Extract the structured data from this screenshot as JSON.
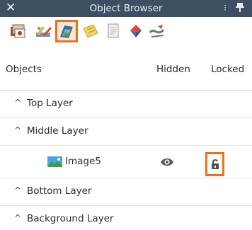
{
  "window": {
    "title": "Object Browser",
    "close_glyph": "✕",
    "menu_glyph": "⁝"
  },
  "toolbar": {
    "tools": [
      {
        "name": "objects-tool-icon"
      },
      {
        "name": "paths-tool-icon"
      },
      {
        "name": "images-tool-icon",
        "active": true
      },
      {
        "name": "notes-tool-icon"
      },
      {
        "name": "pages-tool-icon"
      },
      {
        "name": "shapes-tool-icon"
      },
      {
        "name": "strokes-tool-icon"
      }
    ]
  },
  "columns": {
    "objects": "Objects",
    "hidden": "Hidden",
    "locked": "Locked"
  },
  "layers": [
    {
      "label": "Top Layer",
      "chevron": "^"
    },
    {
      "label": "Middle Layer",
      "chevron": "^"
    },
    {
      "label": "Bottom Layer",
      "chevron": "^"
    },
    {
      "label": "Background Layer",
      "chevron": "^"
    }
  ],
  "middle_layer_item": {
    "label": "Image5",
    "hidden_icon": "eye-icon",
    "locked_icon": "unlocked-padlock-icon"
  },
  "colors": {
    "titlebar": "#3d4f63",
    "highlight": "#e8711d"
  }
}
